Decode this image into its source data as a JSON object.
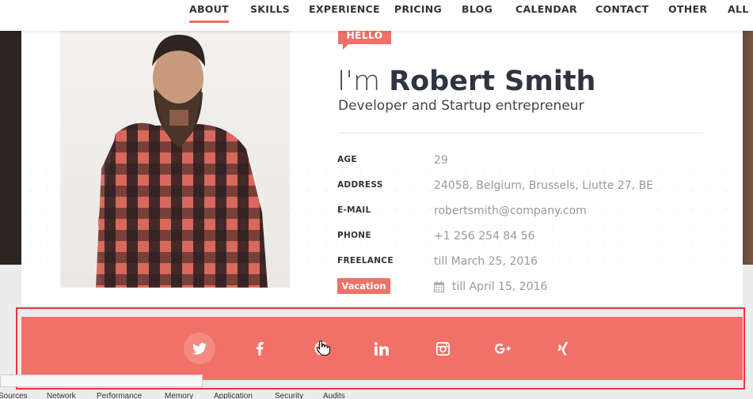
{
  "nav": {
    "items": [
      "ABOUT",
      "SKILLS",
      "EXPERIENCE",
      "PRICING",
      "BLOG",
      "CALENDAR",
      "CONTACT",
      "OTHER",
      "ALL D"
    ],
    "active": "ABOUT"
  },
  "profile": {
    "hello_badge": "HELLO",
    "greeting": "I'm",
    "name": "Robert Smith",
    "role": "Developer and Startup entrepreneur",
    "details": [
      {
        "label": "AGE",
        "value": "29"
      },
      {
        "label": "ADDRESS",
        "value": "24058, Belgium, Brussels, Liutte 27, BE"
      },
      {
        "label": "E-MAIL",
        "value": "robertsmith@company.com"
      },
      {
        "label": "PHONE",
        "value": "+1 256 254 84 56"
      },
      {
        "label": "FREELANCE",
        "value": "till March 25, 2016"
      }
    ],
    "vacation_label": "Vacation",
    "vacation_value": "till April 15, 2016"
  },
  "social": {
    "icons": [
      "twitter-icon",
      "facebook-icon",
      "dribbble-icon",
      "linkedin-icon",
      "instagram-icon",
      "google-plus-icon",
      "xing-icon"
    ],
    "hovered": "twitter-icon"
  },
  "devtools": {
    "tabs": [
      "Sources",
      "Network",
      "Performance",
      "Memory",
      "Application",
      "Security",
      "Audits"
    ]
  },
  "colors": {
    "accent": "#f07167",
    "highlight_outline": "#e8343e"
  }
}
